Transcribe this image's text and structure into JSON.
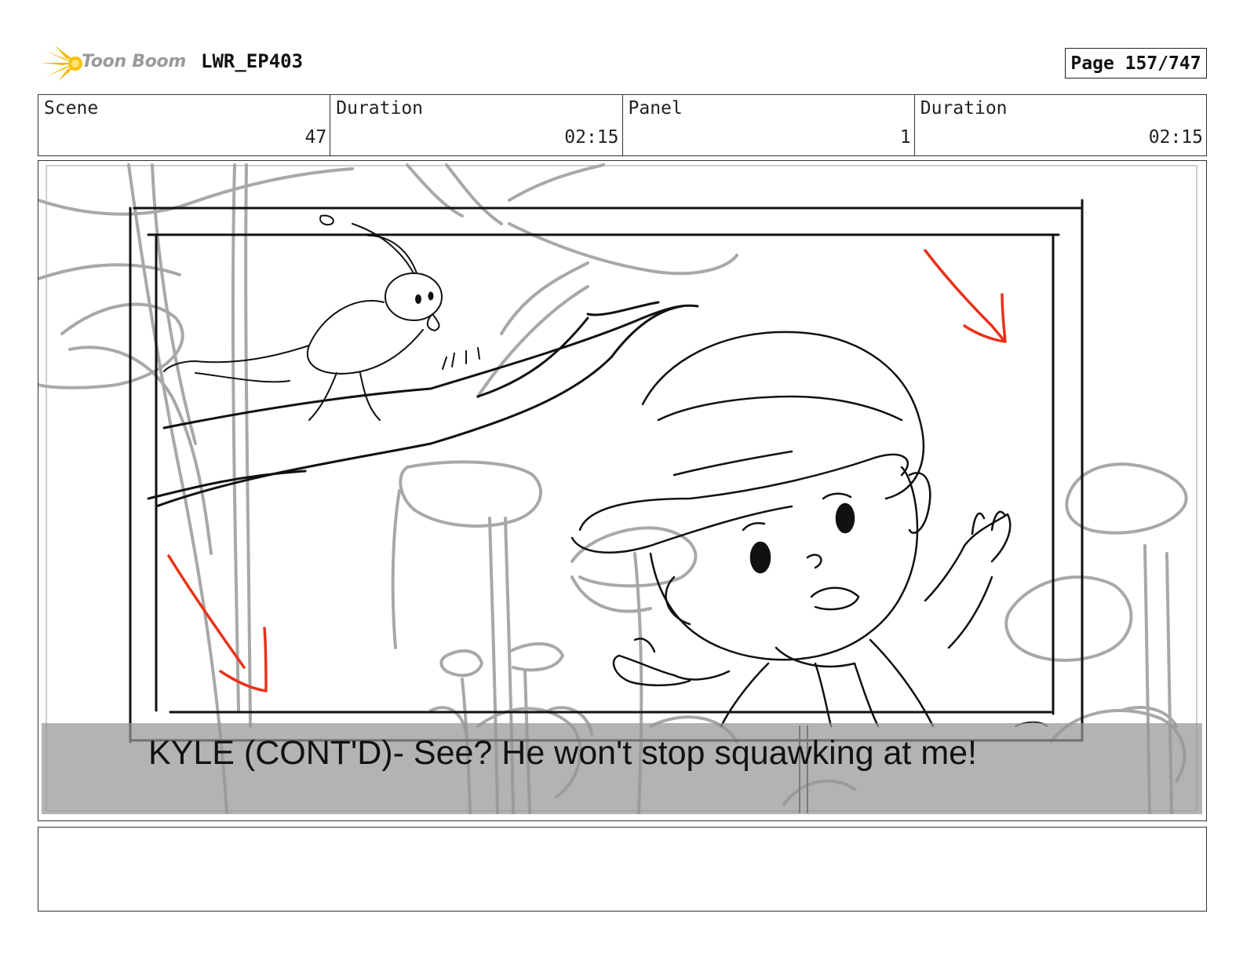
{
  "header": {
    "logo_text": "Toon Boom",
    "project": "LWR_EP403",
    "page": "Page 157/747"
  },
  "info": {
    "scene_label": "Scene",
    "scene_value": "47",
    "duration_label": "Duration",
    "duration_value": "02:15",
    "panel_label": "Panel",
    "panel_value": "1",
    "panel_duration_label": "Duration",
    "panel_duration_value": "02:15"
  },
  "panel": {
    "caption": "KYLE (CONT'D)- See? He won't stop squawking at me!",
    "arrow_color": "#e8321a"
  },
  "notes": {
    "text": ""
  }
}
